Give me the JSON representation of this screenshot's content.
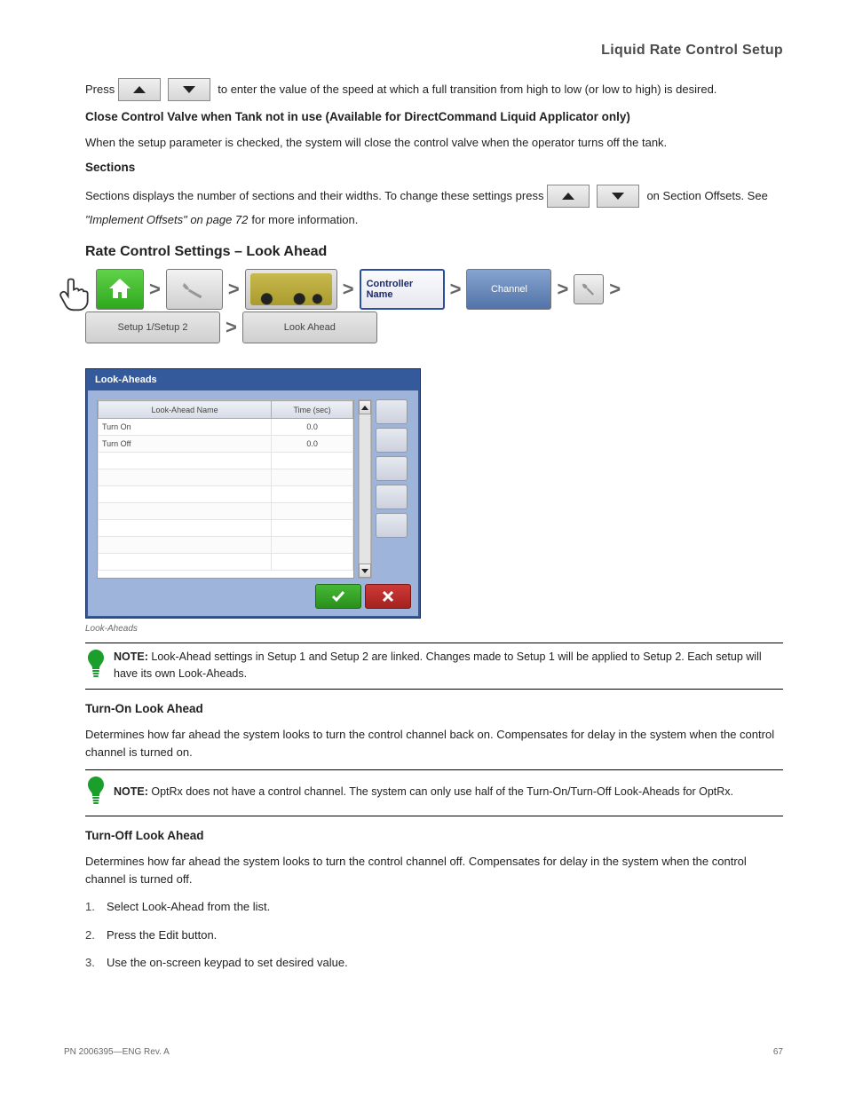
{
  "page_header": "Liquid Rate Control Setup",
  "intro_para_a": "Press ",
  "intro_para_b": " to enter the value of the speed at which a full transition from high to low (or low to high) is desired.",
  "section_cctv": {
    "title": "Close Control Valve when Tank not in use (Available for DirectCommand Liquid Applicator only)",
    "body": "When the setup parameter is checked, the system will close the control valve when the operator turns off the tank."
  },
  "sections_heading": "Sections",
  "sections_para_a": "Sections displays the number of sections and their widths. To change these settings press ",
  "sections_para_b": " on Section Offsets. See ",
  "sections_link": "\"Implement Offsets\" on page 72",
  "sections_para_c": " for more information.",
  "rate_look_heading": "Rate Control Settings – Look Ahead",
  "breadcrumb": {
    "controller": "Controller Name",
    "channel": "Channel",
    "setup1": "Setup 1/Setup 2",
    "lookahead": "Look Ahead"
  },
  "dialog": {
    "title": "Look-Aheads",
    "col1": "Look-Ahead Name",
    "col2": "Time (sec)",
    "rows": [
      {
        "name": "Turn On",
        "time": "0.0"
      },
      {
        "name": "Turn Off",
        "time": "0.0"
      }
    ],
    "caption": "Look-Aheads"
  },
  "note1_label": "NOTE:",
  "note1_text": " Look-Ahead settings in Setup 1 and Setup 2 are linked. Changes made to Setup 1 will be applied to Setup 2. Each setup will have its own Look-Aheads.",
  "turnon_heading": "Turn-On Look Ahead",
  "turnon_body": "Determines how far ahead the system looks to turn the control channel back on. Compensates for delay in the system when the control channel is turned on.",
  "note2_label": "NOTE:",
  "note2_text": " OptRx does not have a control channel. The system can only use half of the Turn-On/Turn-Off Look-Aheads for OptRx.",
  "turnoff_heading": "Turn-Off Look Ahead",
  "turnoff_body": "Determines how far ahead the system looks to turn the control channel off. Compensates for delay in the system when the control channel is turned off.",
  "steps": [
    "Select Look-Ahead from the list.",
    "Press the Edit button.",
    "Use the on-screen keypad to set desired value."
  ],
  "footer": {
    "pn": "PN 2006395—ENG Rev. A",
    "page": "67"
  }
}
